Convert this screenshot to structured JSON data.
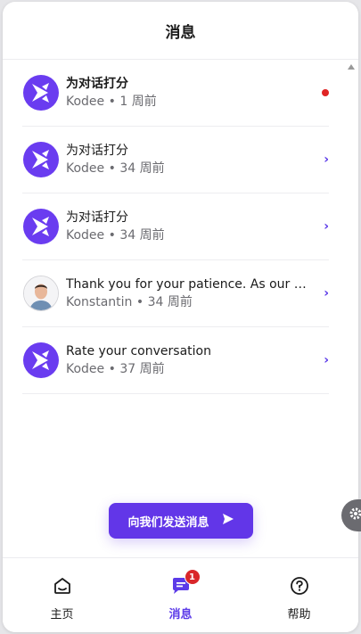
{
  "header": {
    "title": "消息"
  },
  "messages": [
    {
      "title": "为对话打分",
      "sender": "Kodee",
      "time": "1 周前",
      "unread": true,
      "avatar": "kodee-logo-icon"
    },
    {
      "title": "为对话打分",
      "sender": "Kodee",
      "time": "34 周前",
      "unread": false,
      "avatar": "kodee-logo-icon"
    },
    {
      "title": "为对话打分",
      "sender": "Kodee",
      "time": "34 周前",
      "unread": false,
      "avatar": "kodee-logo-icon"
    },
    {
      "title": "Thank you for your patience. As our s...",
      "sender": "Konstantin",
      "time": "34 周前",
      "unread": false,
      "avatar": "user-photo"
    },
    {
      "title": "Rate your conversation",
      "sender": "Kodee",
      "time": "37 周前",
      "unread": false,
      "avatar": "kodee-logo-icon"
    }
  ],
  "separator": "•",
  "send_button": {
    "label": "向我们发送消息",
    "icon": "send-arrow-icon"
  },
  "nav": {
    "home": {
      "label": "主页",
      "icon": "home-icon"
    },
    "messages": {
      "label": "消息",
      "icon": "chat-icon",
      "badge": "1"
    },
    "help": {
      "label": "帮助",
      "icon": "help-circle-icon"
    }
  },
  "colors": {
    "accent": "#6236e8",
    "unread_dot": "#e02424",
    "badge": "#d9262a"
  }
}
